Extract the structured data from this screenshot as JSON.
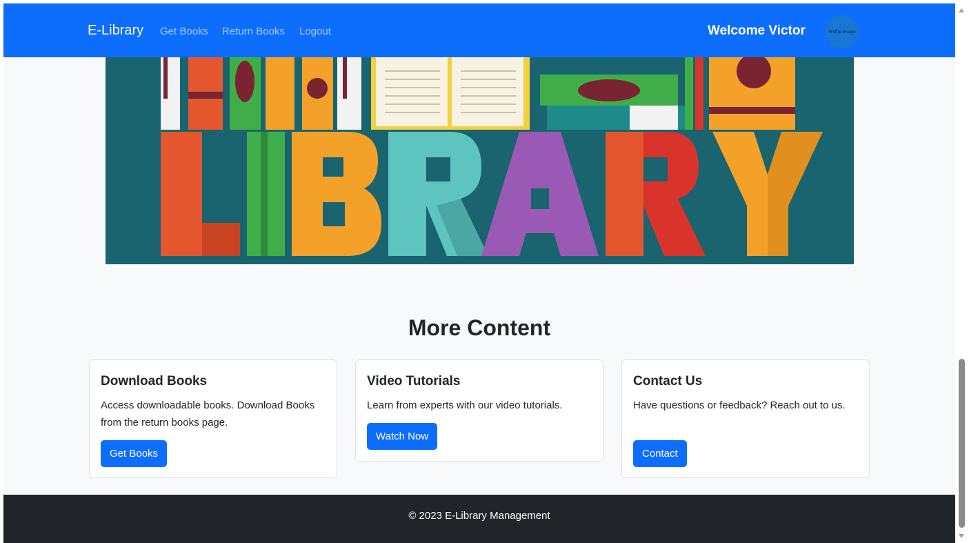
{
  "navbar": {
    "brand": "E-Library",
    "links": [
      "Get Books",
      "Return Books",
      "Logout"
    ],
    "welcome": "Welcome Victor",
    "avatar_alt": "Profile Image"
  },
  "hero": {
    "word": "LIBRARY",
    "colors": {
      "background": "#19646e",
      "L": "#e4572e",
      "I": "#3fae49",
      "B": "#f4a12a",
      "R1": "#5ec4c0",
      "A": "#9b59b6",
      "R2": "#d9342b",
      "Y": "#f4a12a"
    }
  },
  "section": {
    "title": "More Content",
    "cards": [
      {
        "title": "Download Books",
        "text": "Access downloadable books. Download Books from the return books page.",
        "button": "Get Books"
      },
      {
        "title": "Video Tutorials",
        "text": "Learn from experts with our video tutorials.",
        "button": "Watch Now"
      },
      {
        "title": "Contact Us",
        "text": "Have questions or feedback? Reach out to us.",
        "button": "Contact"
      }
    ]
  },
  "footer": {
    "text": "© 2023 E-Library Management"
  },
  "theme": {
    "primary": "#0d6efd",
    "dark": "#212529",
    "page_bg": "#f8f9fa"
  }
}
